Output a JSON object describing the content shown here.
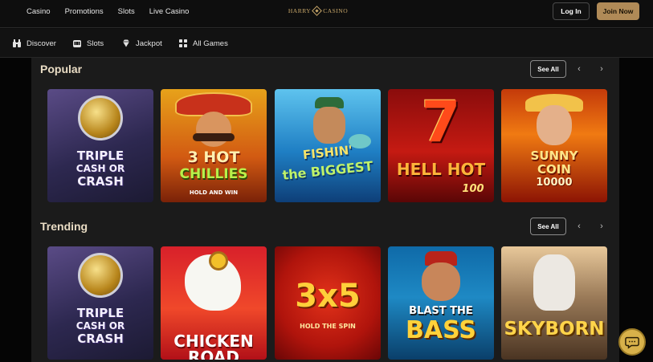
{
  "topnav": [
    "Casino",
    "Promotions",
    "Slots",
    "Live Casino"
  ],
  "logo": {
    "left": "HARRY",
    "right": "CASINO"
  },
  "auth": {
    "login": "Log In",
    "join": "Join Now"
  },
  "subnav": [
    {
      "label": "Discover",
      "icon": "binoculars-icon"
    },
    {
      "label": "Slots",
      "icon": "slot-machine-icon"
    },
    {
      "label": "Jackpot",
      "icon": "diamond-icon"
    },
    {
      "label": "All Games",
      "icon": "grid-icon"
    }
  ],
  "sections": [
    {
      "title": "Popular",
      "see_all": "See All",
      "prev": "‹",
      "next": "›",
      "games": [
        {
          "l1": "TRIPLE",
          "l2": "CASH OR",
          "l3": "CRASH"
        },
        {
          "l1": "3 HOT",
          "l2": "CHILLIES",
          "l3": "HOLD AND WIN"
        },
        {
          "l1": "FISHIN'",
          "l2": "the BIGGEST",
          "l3": ""
        },
        {
          "l1": "7",
          "l2": "HELL HOT",
          "l3": "100"
        },
        {
          "l1": "SUNNY",
          "l2": "COIN",
          "l3": "10000"
        }
      ]
    },
    {
      "title": "Trending",
      "see_all": "See All",
      "prev": "‹",
      "next": "›",
      "games": [
        {
          "l1": "TRIPLE",
          "l2": "CASH OR",
          "l3": "CRASH"
        },
        {
          "l1": "",
          "l2": "CHICKEN",
          "l3": "ROAD"
        },
        {
          "l1": "3x5",
          "l2": "HOLD THE SPIN",
          "l3": ""
        },
        {
          "l1": "BLAST THE",
          "l2": "BASS",
          "l3": ""
        },
        {
          "l1": "",
          "l2": "SKYBORN",
          "l3": ""
        }
      ]
    }
  ],
  "colors": {
    "accent": "#b08a57",
    "chat": "#d8b14a"
  }
}
